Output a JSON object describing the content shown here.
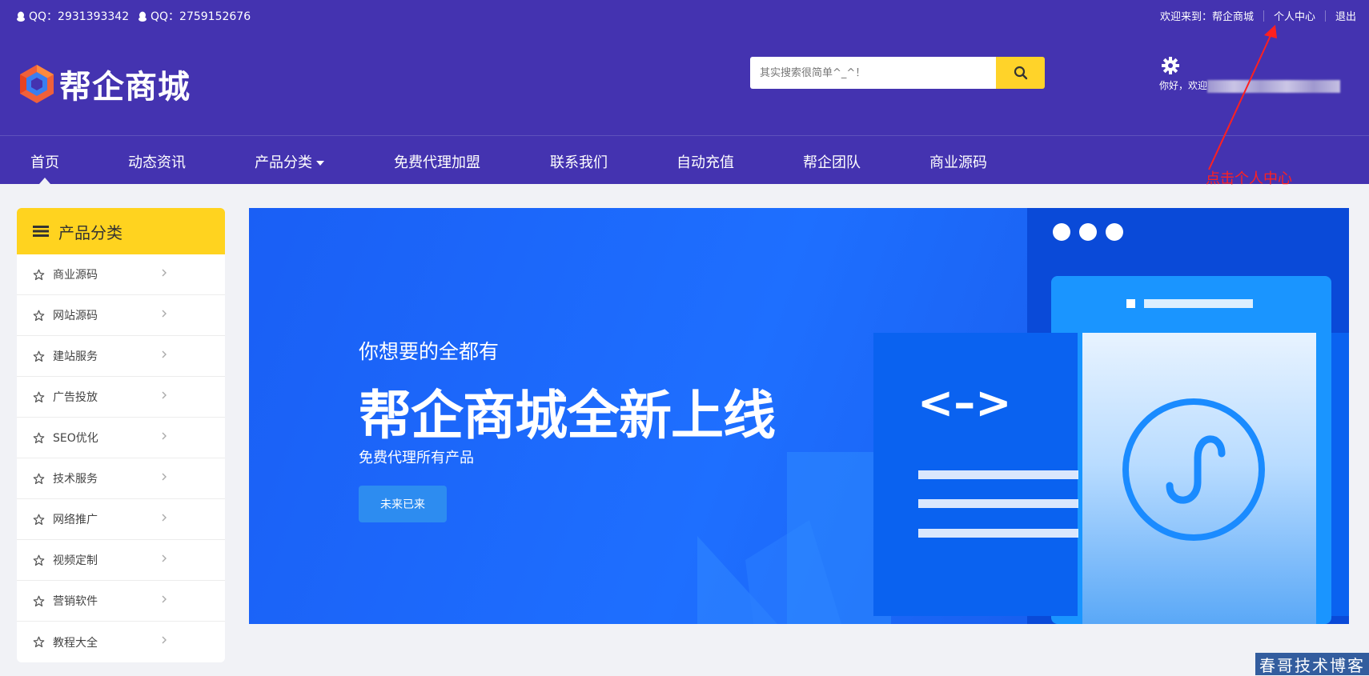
{
  "topbar": {
    "qq1": "QQ：2931393342",
    "qq2": "QQ：2759152676",
    "welcome": "欢迎来到：",
    "site_name": "帮企商城",
    "user_center": "个人中心",
    "logout": "退出"
  },
  "logo": {
    "text": "帮企商城"
  },
  "search": {
    "placeholder": "其实搜索很简单^_^！",
    "icon": "search-icon"
  },
  "user": {
    "greeting": "你好，欢迎",
    "icon": "gear-icon"
  },
  "nav": {
    "items": [
      {
        "label": "首页"
      },
      {
        "label": "动态资讯"
      },
      {
        "label": "产品分类"
      },
      {
        "label": "免费代理加盟"
      },
      {
        "label": "联系我们"
      },
      {
        "label": "自动充值"
      },
      {
        "label": "帮企团队"
      },
      {
        "label": "商业源码"
      }
    ]
  },
  "annotation": {
    "text": "点击个人中心",
    "color": "#ff2020"
  },
  "sidebar": {
    "title": "产品分类",
    "items": [
      {
        "label": "商业源码"
      },
      {
        "label": "网站源码"
      },
      {
        "label": "建站服务"
      },
      {
        "label": "广告投放"
      },
      {
        "label": "SEO优化"
      },
      {
        "label": "技术服务"
      },
      {
        "label": "网络推广"
      },
      {
        "label": "视频定制"
      },
      {
        "label": "营销软件"
      },
      {
        "label": "教程大全"
      }
    ]
  },
  "banner": {
    "subtitle": "你想要的全都有",
    "title": "帮企商城全新上线",
    "desc": "免费代理所有产品",
    "button": "未来已来",
    "code_symbol": "<–>"
  },
  "watermark": {
    "text": "春哥技术博客"
  },
  "colors": {
    "header": "#4433b0",
    "accent": "#ffd329",
    "banner": "#1e6fff"
  }
}
